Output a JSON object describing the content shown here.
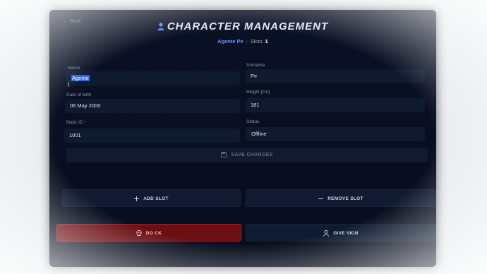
{
  "header": {
    "back_label": "← Back",
    "title": "CHARACTER MANAGEMENT",
    "character_name": "Agente Pe",
    "slots_label": "Slots:",
    "slots_value": "1"
  },
  "form": {
    "name_label": "Name",
    "name_value_highlighted": "Agente",
    "surname_label": "Surname",
    "surname_value": "Pe",
    "dob_label": "Date of birth",
    "dob_value": "06 May 2000",
    "height_label": "Height [cm]",
    "height_value": "181",
    "static_id_label": "Static ID",
    "static_id_required": "*",
    "static_id_value": "1001",
    "status_label": "Status",
    "status_value": "Offline"
  },
  "buttons": {
    "save_label": "SAVE CHANGES",
    "add_slot_label": "ADD SLOT",
    "remove_slot_label": "REMOVE SLOT",
    "ck_label": "DO CK",
    "give_skin_label": "GIVE SKIN"
  },
  "colors": {
    "accent": "#5f9bff",
    "danger": "#b01c22",
    "panel_bg": "#0a1124"
  },
  "icons": [
    "user-icon",
    "save-icon",
    "plus-icon",
    "minus-icon",
    "skull-icon",
    "person-icon"
  ]
}
